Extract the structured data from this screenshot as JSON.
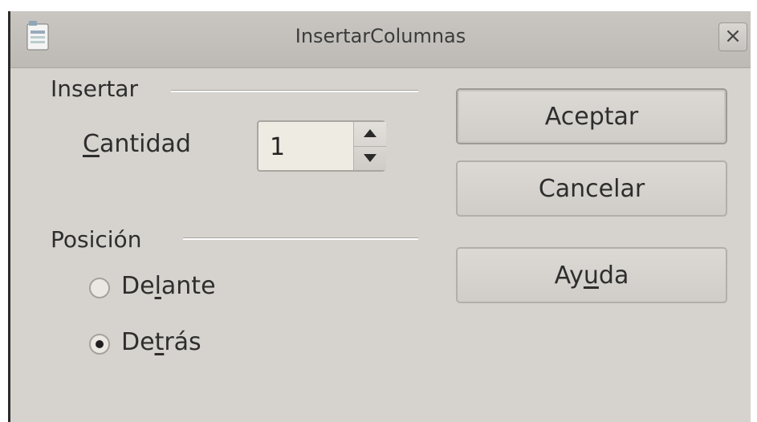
{
  "window": {
    "title": "InsertarColumnas",
    "close_label": "×"
  },
  "insert_section": {
    "label": "Insertar",
    "quantity": {
      "label_accel": "C",
      "label_rest": "antidad",
      "value": "1"
    }
  },
  "position_section": {
    "label": "Posición",
    "options": [
      {
        "pre": "De",
        "accel": "l",
        "post": "ante",
        "selected": false
      },
      {
        "pre": "De",
        "accel": "t",
        "post": "rás",
        "selected": true
      }
    ]
  },
  "buttons": {
    "ok": "Aceptar",
    "cancel": "Cancelar",
    "help_pre": "Ay",
    "help_accel": "u",
    "help_post": "da"
  }
}
